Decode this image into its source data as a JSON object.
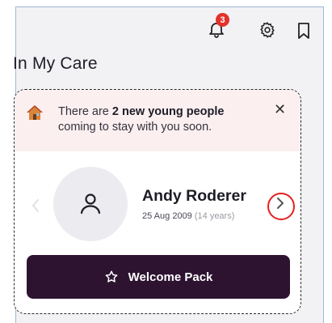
{
  "header": {
    "notification_count": "3",
    "icons": [
      "bell-icon",
      "gear-icon",
      "bookmark-icon"
    ]
  },
  "page_title": "In My Care",
  "banner": {
    "text_before": "There are ",
    "text_bold": "2 new young people",
    "text_after": " coming to stay with you soon.",
    "close_label": "✕"
  },
  "person": {
    "name": "Andy Roderer",
    "dob": "25 Aug 2009",
    "age": "(14 years)"
  },
  "welcome_button": {
    "label": "Welcome Pack"
  },
  "colors": {
    "accent": "#2e1331",
    "badge": "#e3322b",
    "banner_bg": "#fbeff0",
    "highlight_ring": "#e32020"
  }
}
